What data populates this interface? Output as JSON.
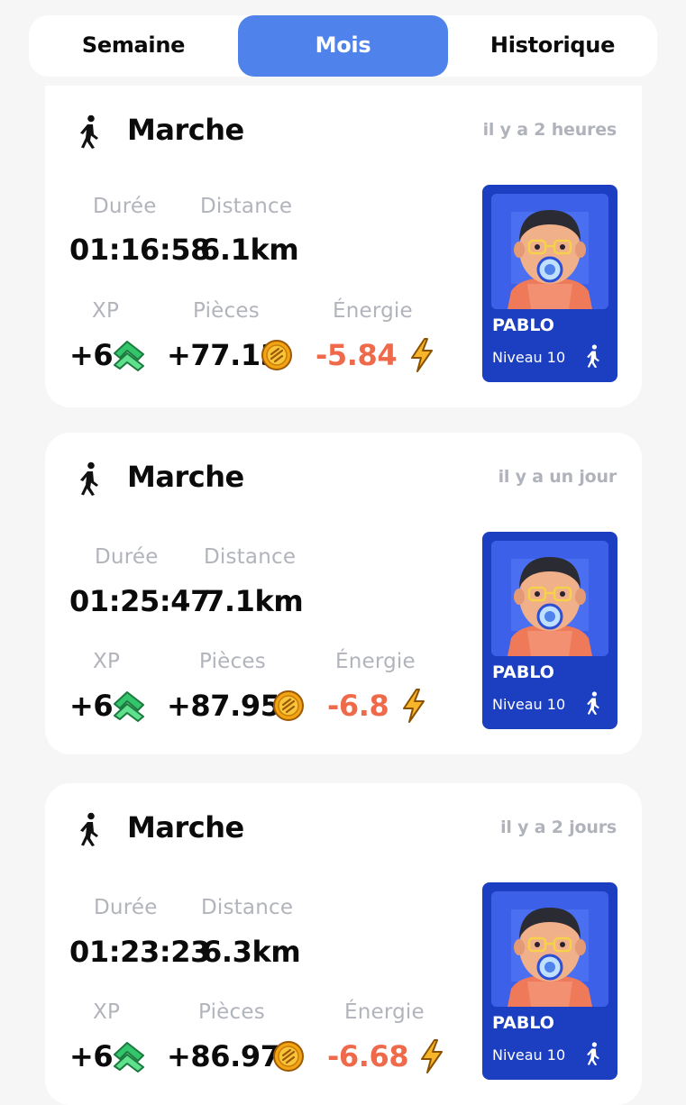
{
  "tabs": [
    "Semaine",
    "Mois",
    "Historique"
  ],
  "active_tab": "Mois",
  "labels": {
    "duration": "Durée",
    "distance": "Distance",
    "xp": "XP",
    "coins": "Pièces",
    "energy": "Énergie"
  },
  "activities": [
    {
      "title": "Marche",
      "time_ago": "il y a 2 heures",
      "duration": "01:16:58",
      "distance": "6.1km",
      "xp": "+6",
      "coins": "+77.13",
      "energy": "-5.84",
      "nft": {
        "name": "PABLO",
        "level": "Niveau 10"
      }
    },
    {
      "title": "Marche",
      "time_ago": "il y a un jour",
      "duration": "01:25:47",
      "distance": "7.1km",
      "xp": "+6",
      "coins": "+87.95",
      "energy": "-6.8",
      "nft": {
        "name": "PABLO",
        "level": "Niveau 10"
      }
    },
    {
      "title": "Marche",
      "time_ago": "il y a 2 jours",
      "duration": "01:23:23",
      "distance": "6.3km",
      "xp": "+6",
      "coins": "+86.97",
      "energy": "-6.68",
      "nft": {
        "name": "PABLO",
        "level": "Niveau 10"
      }
    }
  ],
  "icons": {
    "activity": "walking-person-icon",
    "xp": "double-chevron-up-icon",
    "coins": "coin-icon",
    "energy": "lightning-icon"
  },
  "colors": {
    "tab_active": "#4f82ea",
    "energy_negative": "#ef6a4a",
    "xp_green": "#34c46b",
    "coin": "#f2a413",
    "nft_card": "#1c3ec0"
  }
}
